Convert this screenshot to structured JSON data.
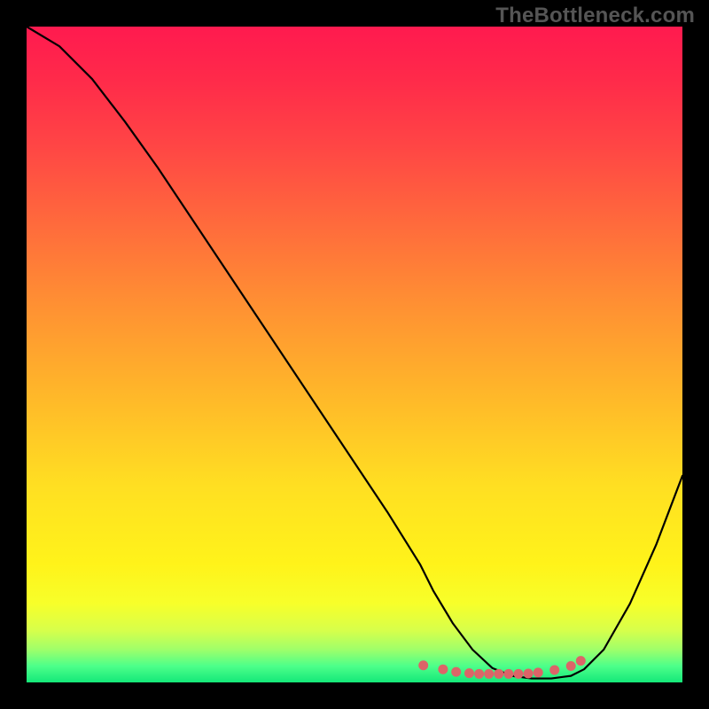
{
  "watermark": "TheBottleneck.com",
  "chart_data": {
    "type": "line",
    "title": "",
    "xlabel": "",
    "ylabel": "",
    "xlim": [
      0,
      100
    ],
    "ylim": [
      0,
      100
    ],
    "grid": false,
    "series": [
      {
        "name": "curve",
        "x": [
          0,
          5,
          10,
          15,
          20,
          25,
          30,
          35,
          40,
          45,
          50,
          55,
          60,
          62,
          65,
          68,
          71,
          74,
          77,
          80,
          83,
          85,
          88,
          92,
          96,
          100
        ],
        "y": [
          100,
          97,
          92,
          85.5,
          78.5,
          71,
          63.5,
          56,
          48.5,
          41,
          33.5,
          26,
          18,
          14,
          9,
          5,
          2.2,
          1.0,
          0.6,
          0.6,
          1.0,
          2.0,
          5,
          12,
          21,
          31.5
        ]
      }
    ],
    "markers": {
      "name": "highlight-dots",
      "x": [
        60.5,
        63.5,
        65.5,
        67.5,
        69,
        70.5,
        72,
        73.5,
        75,
        76.5,
        78,
        80.5,
        83,
        84.5
      ],
      "y": [
        2.6,
        2.0,
        1.6,
        1.4,
        1.3,
        1.3,
        1.3,
        1.3,
        1.3,
        1.35,
        1.5,
        1.9,
        2.5,
        3.3
      ]
    },
    "gradient_stops": [
      {
        "pos": 0.0,
        "color": "#ff1a4f"
      },
      {
        "pos": 0.3,
        "color": "#ff6a3c"
      },
      {
        "pos": 0.55,
        "color": "#ffb42a"
      },
      {
        "pos": 0.82,
        "color": "#fff31a"
      },
      {
        "pos": 1.0,
        "color": "#14e879"
      }
    ]
  }
}
